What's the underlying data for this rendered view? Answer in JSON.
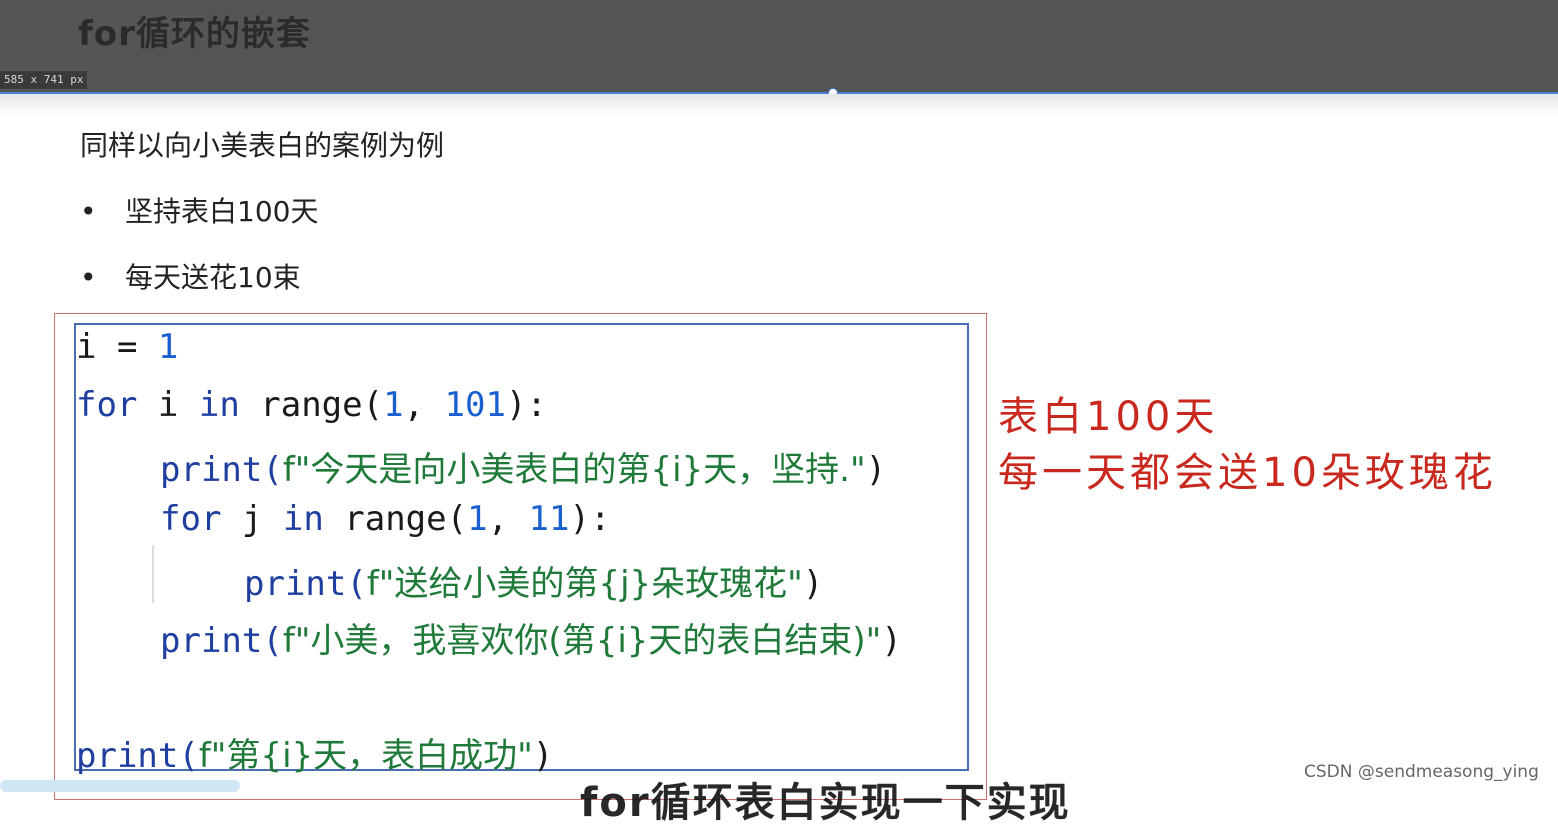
{
  "header": {
    "title": "for循环的嵌套",
    "dimension_label": "585 x 741  px"
  },
  "content": {
    "intro": "同样以向小美表白的案例为例",
    "bullets": [
      "坚持表白100天",
      "每天送花10束"
    ]
  },
  "code": {
    "line1": {
      "a": "i = ",
      "b": "1"
    },
    "line2": {
      "kw1": "for",
      "t1": " i ",
      "kw2": "in",
      "t2": " range(",
      "n1": "1",
      "t3": ", ",
      "n2": "101",
      "t4": "):"
    },
    "line3": {
      "fn": "print(",
      "s": "f\"今天是向小美表白的第{i}天，坚持.\"",
      "end": ")"
    },
    "line4": {
      "kw1": "for",
      "t1": " j ",
      "kw2": "in",
      "t2": " range(",
      "n1": "1",
      "t3": ", ",
      "n2": "11",
      "t4": "):"
    },
    "line5": {
      "fn": "print(",
      "s": "f\"送给小美的第{j}朵玫瑰花\"",
      "end": ")"
    },
    "line6": {
      "fn": "print(",
      "s": "f\"小美，我喜欢你(第{i}天的表白结束)\"",
      "end": ")"
    },
    "line8": {
      "fn": "print(",
      "s": "f\"第{i}天，表白成功\"",
      "end": ")"
    }
  },
  "annotations": {
    "line1": "表白100天",
    "line2": "每一天都会送10朵玫瑰花"
  },
  "subtitle": "for循环表白实现一下实现",
  "watermark": "CSDN @sendmeasong_ying",
  "colors": {
    "annotation": "#c8281e",
    "code_border": "#4a6fb0",
    "selection": "#4a7fd6"
  }
}
